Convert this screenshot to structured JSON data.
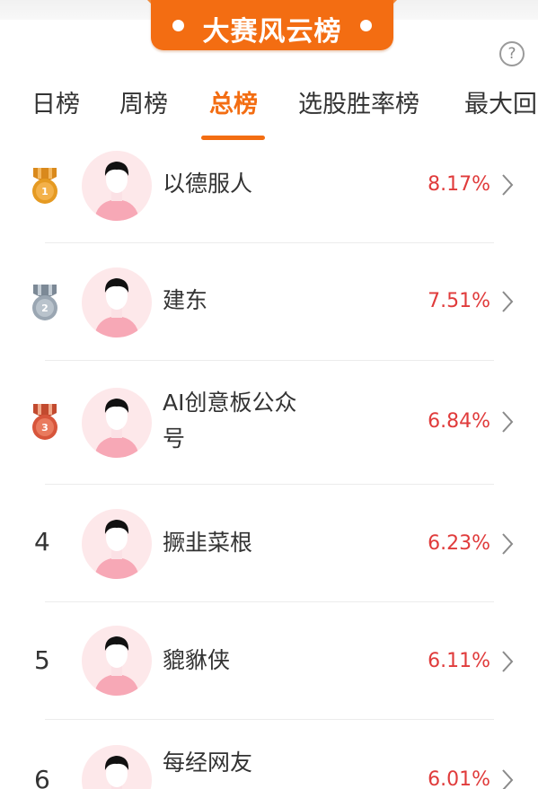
{
  "header": {
    "title": "大赛风云榜",
    "help_label": "?"
  },
  "tabs": [
    {
      "label": "日榜",
      "active": false
    },
    {
      "label": "周榜",
      "active": false
    },
    {
      "label": "总榜",
      "active": true
    },
    {
      "label": "选股胜率榜",
      "active": false
    },
    {
      "label": "最大回",
      "active": false
    }
  ],
  "colors": {
    "accent": "#f36d12",
    "return_red": "#e03b3b",
    "gold": "#e59a22",
    "silver": "#9aa6b2",
    "bronze": "#d7553b"
  },
  "leaderboard": [
    {
      "rank": "1",
      "medal": "gold-medal-icon",
      "name": "以德服人",
      "return": "8.17%"
    },
    {
      "rank": "2",
      "medal": "silver-medal-icon",
      "name": "建东",
      "return": "7.51%"
    },
    {
      "rank": "3",
      "medal": "bronze-medal-icon",
      "name": "AI创意板公众号",
      "return": "6.84%"
    },
    {
      "rank": "4",
      "medal": "",
      "name": "撅韭菜根",
      "return": "6.23%"
    },
    {
      "rank": "5",
      "medal": "",
      "name": "貔貅侠",
      "return": "6.11%"
    },
    {
      "rank": "6",
      "medal": "",
      "name": "每经网友",
      "return": "6.01%"
    }
  ]
}
